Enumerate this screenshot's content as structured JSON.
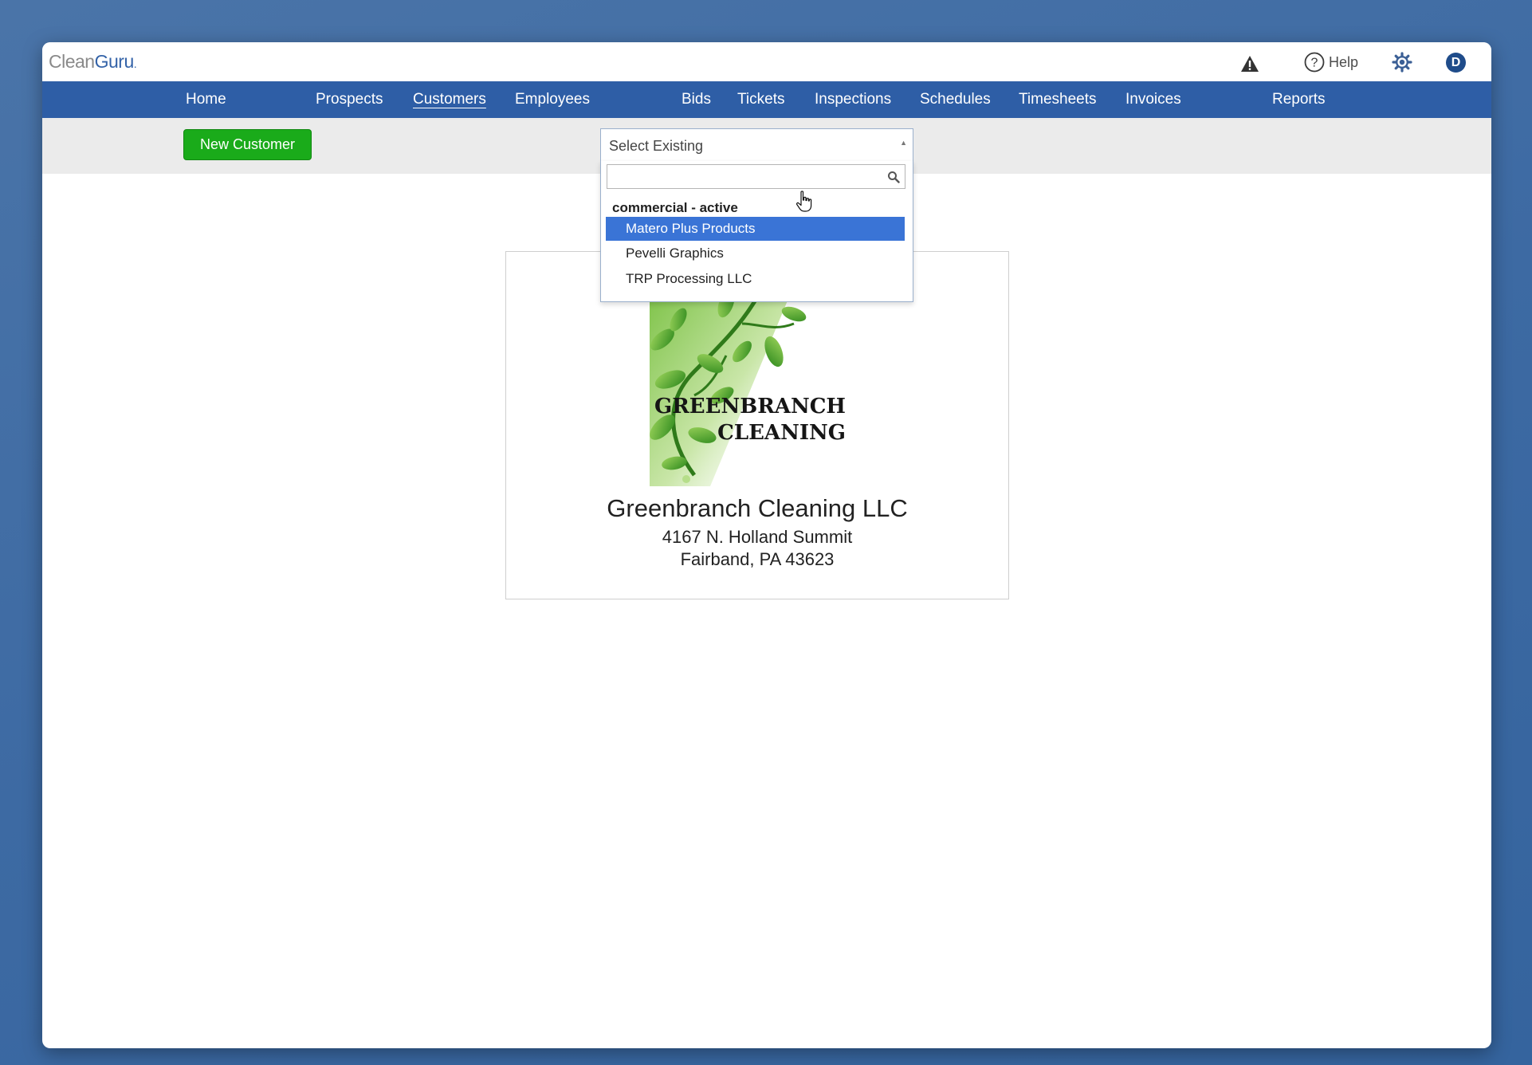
{
  "brand": {
    "clean": "Clean",
    "guru": "Guru",
    "dot": "."
  },
  "header": {
    "help_label": "Help",
    "user_initial": "D"
  },
  "nav": {
    "items": [
      {
        "label": "Home"
      },
      {
        "label": "Prospects"
      },
      {
        "label": "Customers",
        "active": true
      },
      {
        "label": "Employees"
      },
      {
        "label": "Bids"
      },
      {
        "label": "Tickets"
      },
      {
        "label": "Inspections"
      },
      {
        "label": "Schedules"
      },
      {
        "label": "Timesheets"
      },
      {
        "label": "Invoices"
      },
      {
        "label": "Reports"
      }
    ]
  },
  "toolbar": {
    "new_customer_label": "New Customer",
    "select": {
      "selected": "Select Existing",
      "search_value": "",
      "group_label": "commercial - active",
      "options": [
        {
          "label": "Matero Plus Products",
          "highlighted": true
        },
        {
          "label": "Pevelli Graphics"
        },
        {
          "label": "TRP Processing LLC"
        }
      ]
    }
  },
  "company": {
    "logo_line1": "GREENBRANCH",
    "logo_line2": "CLEANING",
    "name": "Greenbranch Cleaning LLC",
    "address1": "4167 N. Holland Summit",
    "address2": "Fairband, PA 43623"
  },
  "colors": {
    "nav_bg": "#2e5ea6",
    "primary_button": "#1aab1a",
    "highlight": "#3a74d6",
    "brand_blue": "#3463a8"
  }
}
